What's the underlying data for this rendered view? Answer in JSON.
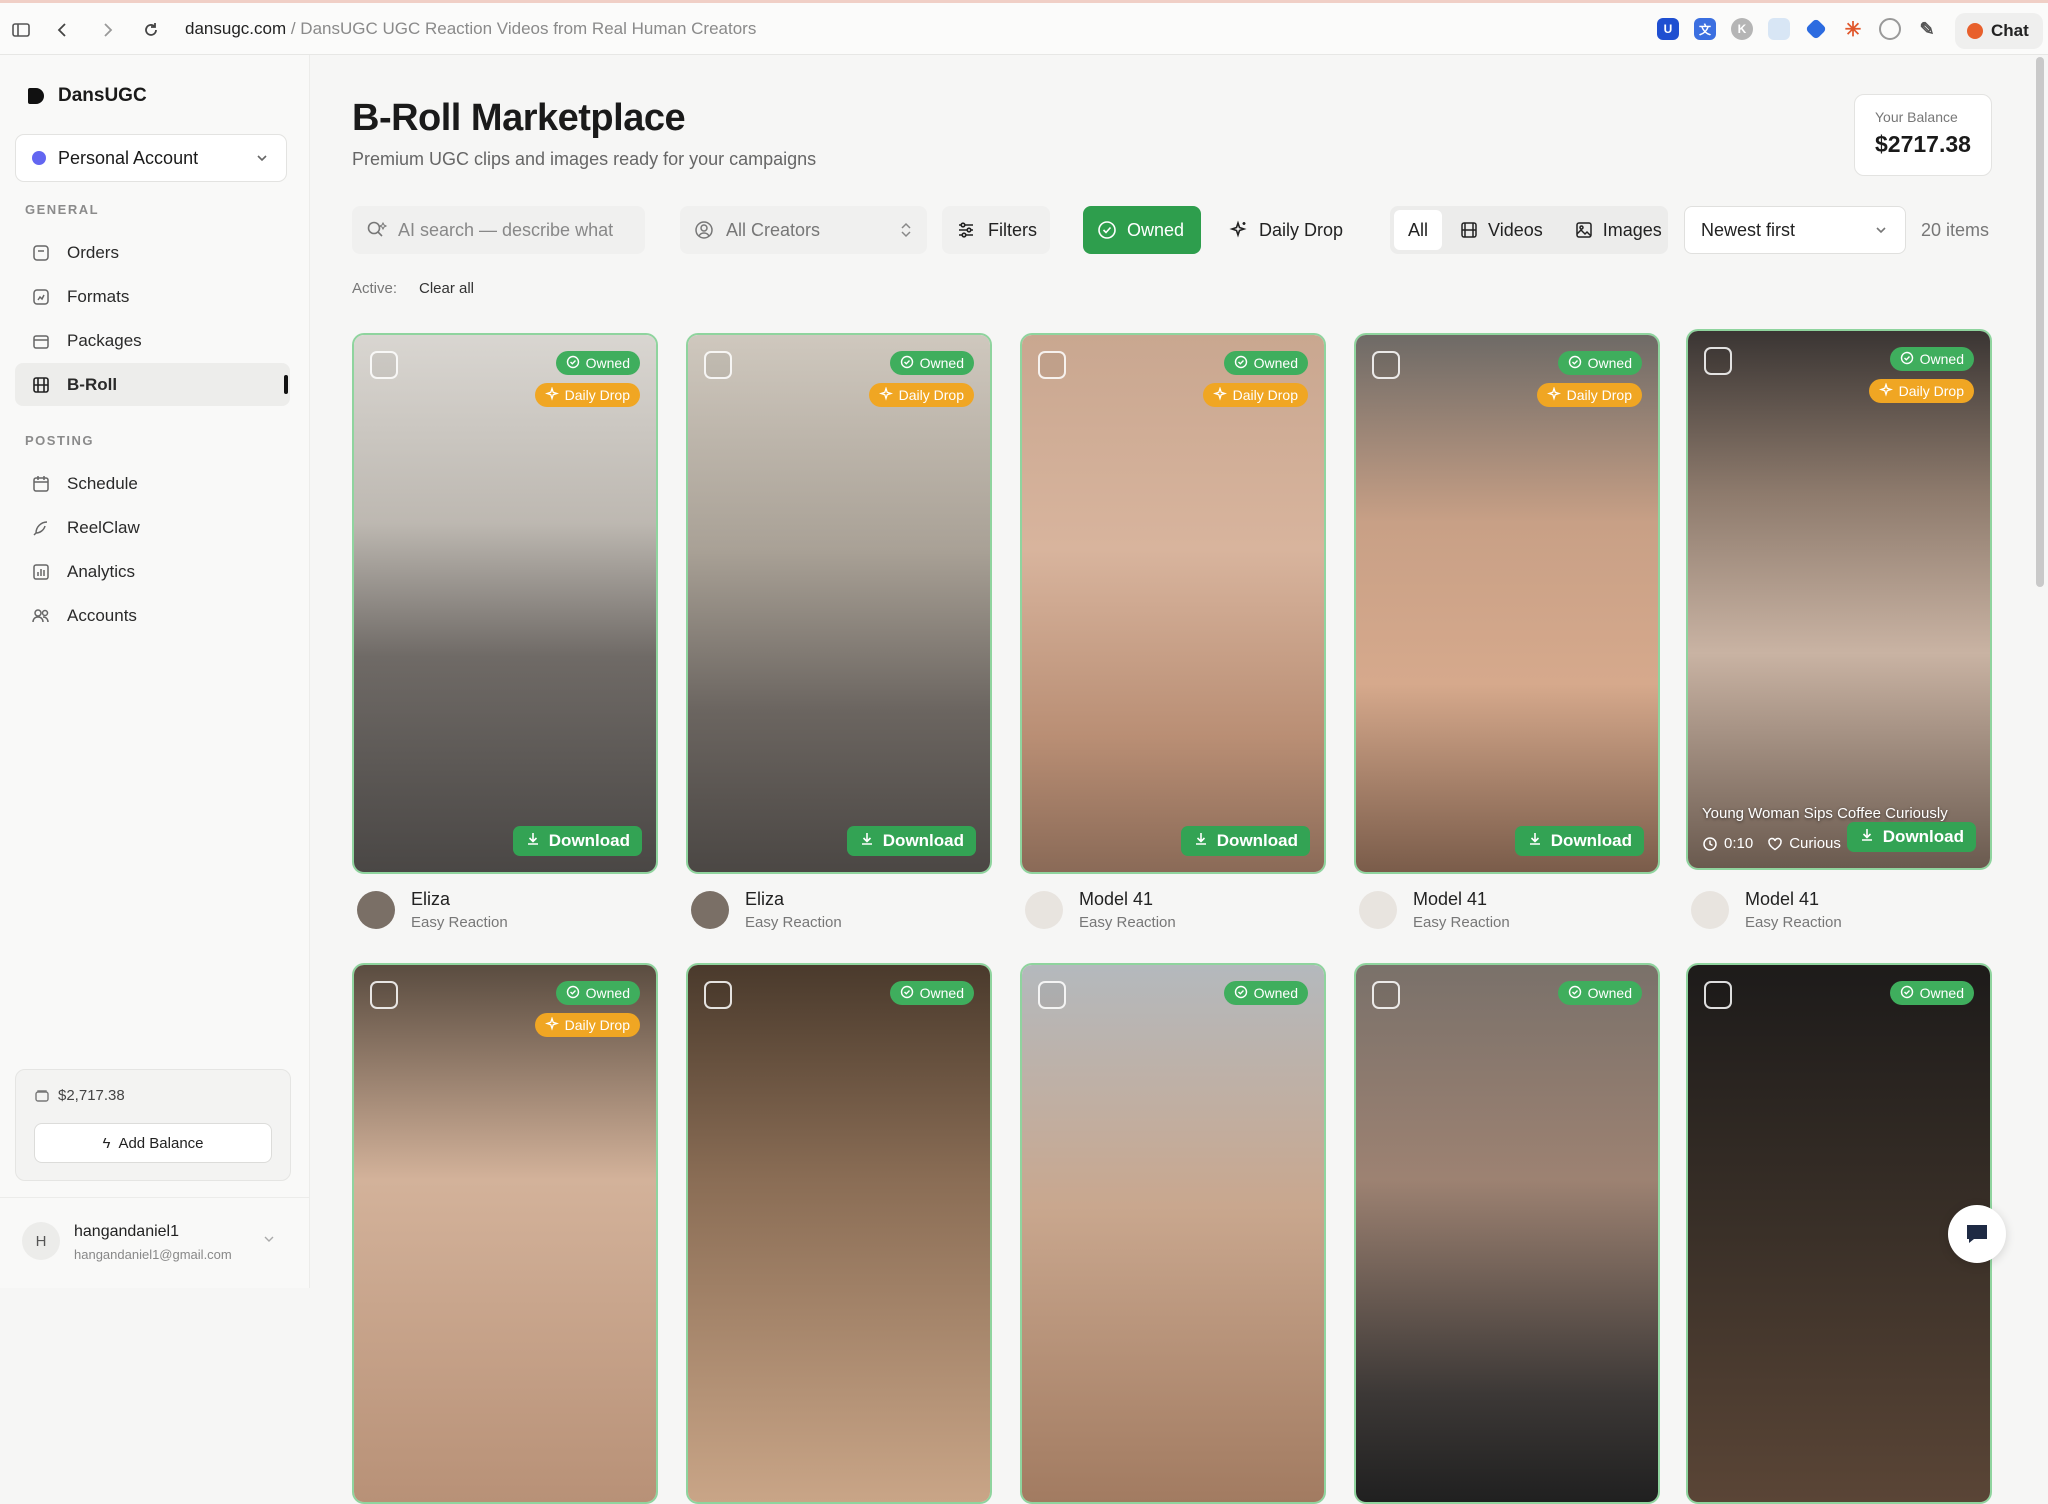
{
  "browser": {
    "domain": "dansugc.com",
    "path_separator": " / ",
    "page_title": "DansUGC UGC Reaction Videos from Real Human Creators",
    "chat_label": "Chat"
  },
  "sidebar": {
    "brand": "DansUGC",
    "account": "Personal Account",
    "general_label": "GENERAL",
    "general_items": [
      {
        "label": "Orders",
        "icon": "orders-icon"
      },
      {
        "label": "Formats",
        "icon": "formats-icon"
      },
      {
        "label": "Packages",
        "icon": "packages-icon"
      },
      {
        "label": "B-Roll",
        "icon": "broll-icon",
        "active": true
      }
    ],
    "posting_label": "POSTING",
    "posting_items": [
      {
        "label": "Schedule",
        "icon": "calendar-icon"
      },
      {
        "label": "ReelClaw",
        "icon": "feather-icon"
      },
      {
        "label": "Analytics",
        "icon": "chart-icon"
      },
      {
        "label": "Accounts",
        "icon": "users-icon"
      }
    ],
    "balance": "$2,717.38",
    "add_balance": "Add Balance",
    "user": {
      "initial": "H",
      "name": "hangandaniel1",
      "email": "hangandaniel1@gmail.com"
    }
  },
  "header": {
    "title": "B-Roll Marketplace",
    "subtitle": "Premium UGC clips and images ready for your campaigns",
    "balance_label": "Your Balance",
    "balance_value": "$2717.38"
  },
  "toolbar": {
    "search_placeholder": "AI search — describe what",
    "creators": "All Creators",
    "filters": "Filters",
    "owned": "Owned",
    "daily_drop": "Daily Drop",
    "seg_all": "All",
    "seg_videos": "Videos",
    "seg_images": "Images",
    "sort": "Newest first",
    "count": "20 items"
  },
  "active": {
    "label": "Active:",
    "clear": "Clear all"
  },
  "badges": {
    "owned": "Owned",
    "daily": "Daily Drop",
    "download": "Download"
  },
  "cards": [
    {
      "creator": "Eliza",
      "type": "Easy Reaction",
      "owned": true,
      "daily": true
    },
    {
      "creator": "Eliza",
      "type": "Easy Reaction",
      "owned": true,
      "daily": true
    },
    {
      "creator": "Model 41",
      "type": "Easy Reaction",
      "owned": true,
      "daily": true
    },
    {
      "creator": "Model 41",
      "type": "Easy Reaction",
      "owned": true,
      "daily": true
    },
    {
      "creator": "Model 41",
      "type": "Easy Reaction",
      "owned": true,
      "daily": true,
      "hover_title": "Young Woman Sips Coffee Curiously",
      "duration": "0:10",
      "mood": "Curious"
    },
    {
      "owned": true,
      "daily": true
    },
    {
      "owned": true,
      "daily": false
    },
    {
      "owned": true,
      "daily": false
    },
    {
      "owned": true,
      "daily": false
    },
    {
      "owned": true,
      "daily": false
    }
  ],
  "colors": {
    "accent_green": "#2e9e4d",
    "daily_orange": "#f0a623",
    "owned_border": "#8fd49e"
  }
}
